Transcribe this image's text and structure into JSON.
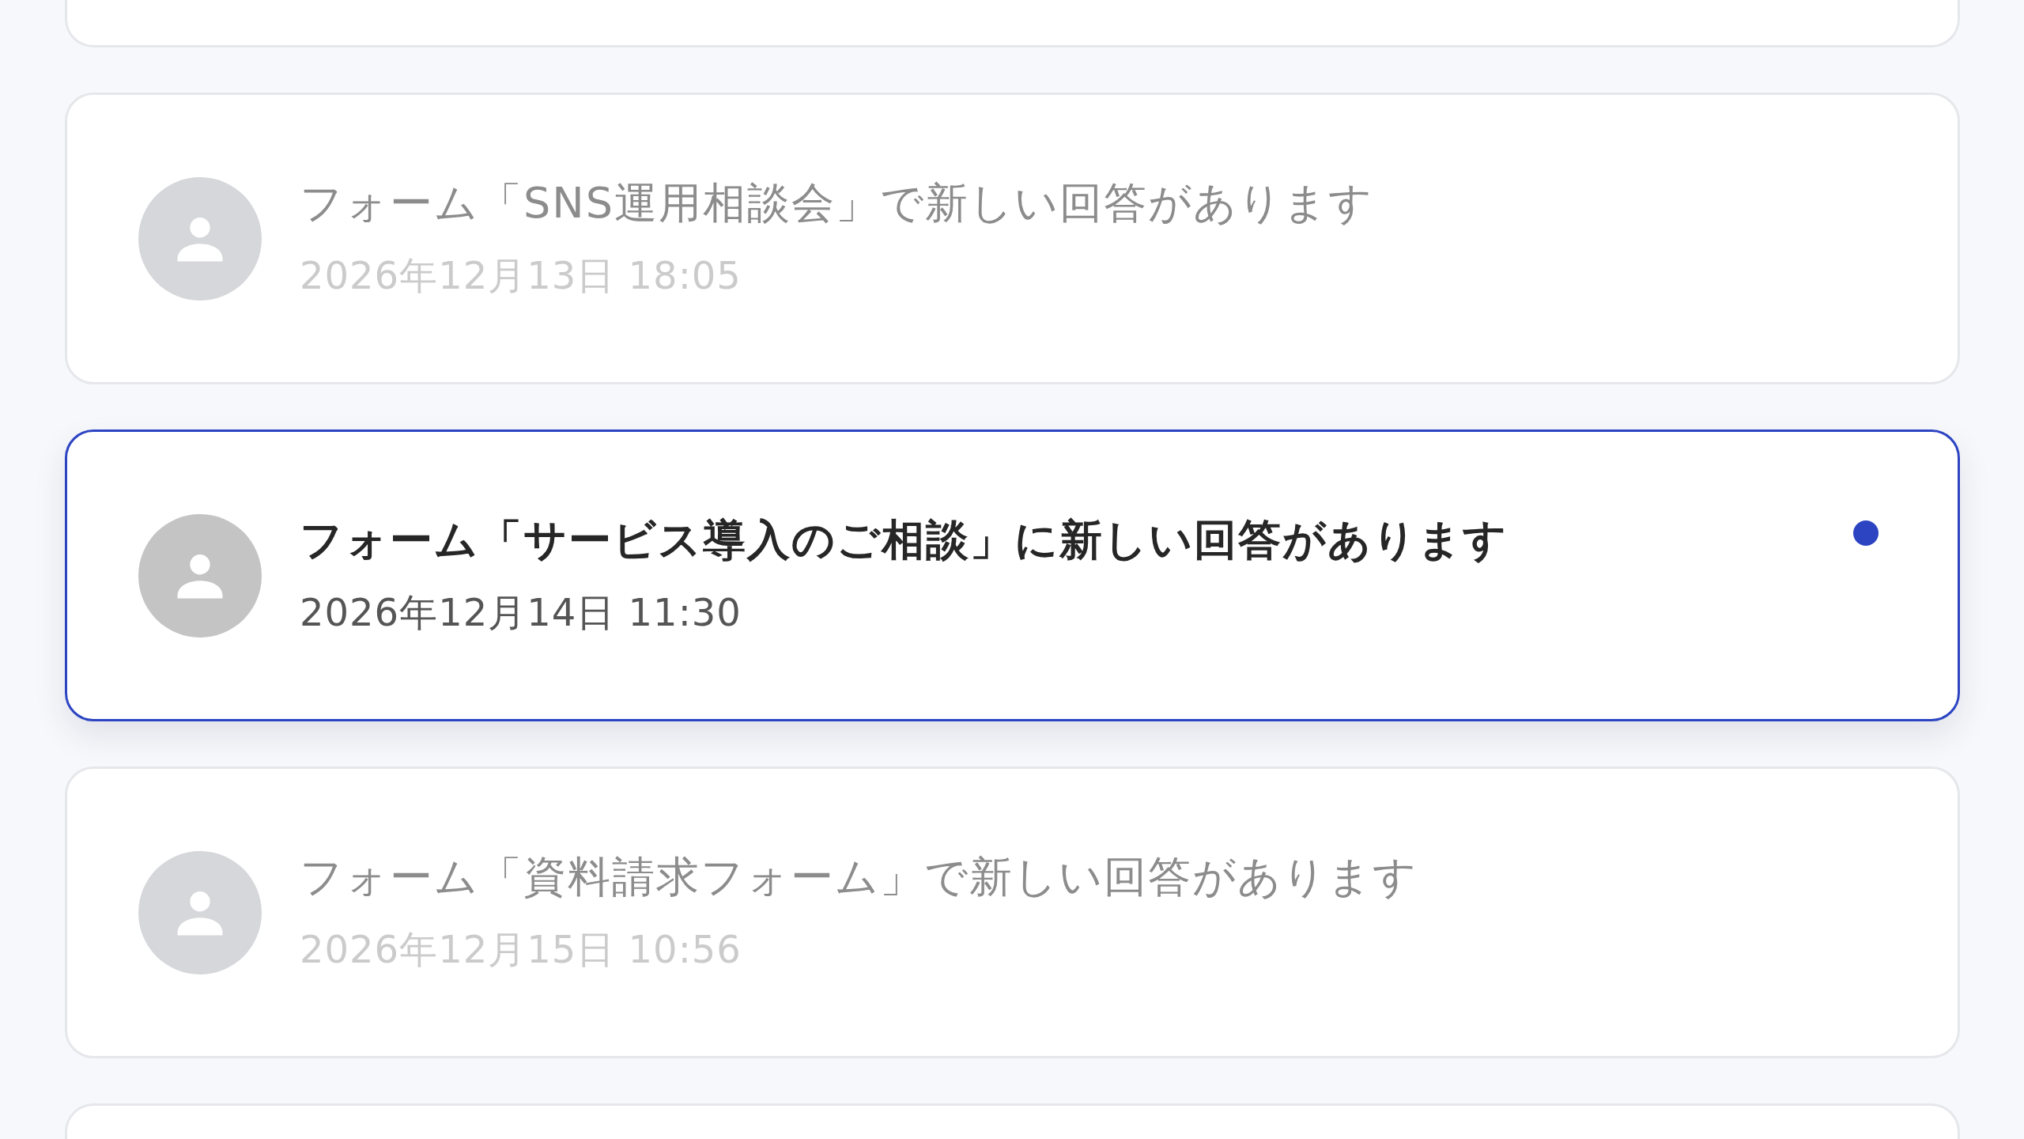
{
  "notifications": [
    {
      "title": "フォーム「SNS運用相談会」で新しい回答があります",
      "date": "2026年12月13日 18:05",
      "unread": false
    },
    {
      "title": "フォーム「サービス導入のご相談」に新しい回答があります",
      "date": "2026年12月14日 11:30",
      "unread": true
    },
    {
      "title": "フォーム「資料請求フォーム」で新しい回答があります",
      "date": "2026年12月15日 10:56",
      "unread": false
    }
  ]
}
